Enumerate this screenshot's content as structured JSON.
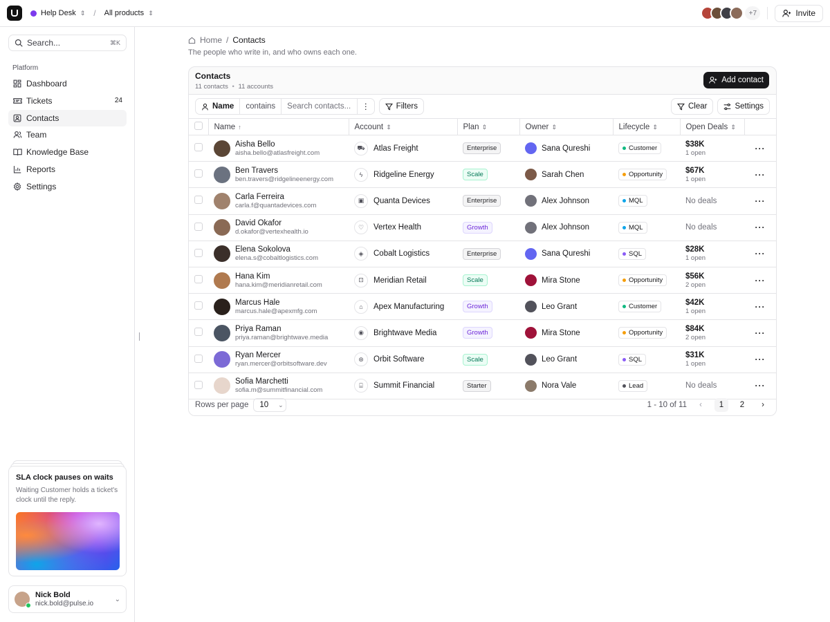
{
  "topbar": {
    "workspace": "Help Desk",
    "product_filter": "All products",
    "separator": "/",
    "team_extra_count": "+7",
    "invite_label": "Invite",
    "avatar_colors": [
      "#b5453a",
      "#6b4f3a",
      "#3f3f46",
      "#8b6b5a"
    ]
  },
  "sidebar": {
    "search_placeholder": "Search...",
    "search_shortcut": "⌘K",
    "section_label": "Platform",
    "items": [
      {
        "label": "Dashboard",
        "icon": "dashboard-icon",
        "count": ""
      },
      {
        "label": "Tickets",
        "icon": "ticket-icon",
        "count": "24"
      },
      {
        "label": "Contacts",
        "icon": "contacts-icon",
        "count": "",
        "active": true
      },
      {
        "label": "Team",
        "icon": "team-icon",
        "count": ""
      },
      {
        "label": "Knowledge Base",
        "icon": "book-icon",
        "count": ""
      },
      {
        "label": "Reports",
        "icon": "chart-icon",
        "count": ""
      },
      {
        "label": "Settings",
        "icon": "gear-icon",
        "count": ""
      }
    ],
    "promo": {
      "title": "SLA clock pauses on waits",
      "text": "Waiting Customer holds a ticket's clock until the reply."
    },
    "user": {
      "name": "Nick Bold",
      "email": "nick.bold@pulse.io"
    }
  },
  "main": {
    "breadcrumb": {
      "home": "Home",
      "separator": "/",
      "current": "Contacts"
    },
    "subtitle": "The people who write in, and who owns each one.",
    "card": {
      "title": "Contacts",
      "contacts_count": "11 contacts",
      "meta_separator": "•",
      "accounts_count": "11 accounts",
      "add_button": "Add contact"
    },
    "toolbar": {
      "filter_field": "Name",
      "filter_operator": "contains",
      "filter_placeholder": "Search contacts...",
      "filters_label": "Filters",
      "clear_label": "Clear",
      "settings_label": "Settings"
    },
    "columns": [
      "Name",
      "Account",
      "Plan",
      "Owner",
      "Lifecycle",
      "Open Deals"
    ],
    "rows": [
      {
        "name": "Aisha Bello",
        "email": "aisha.bello@atlasfreight.com",
        "account": "Atlas Freight",
        "account_icon": "truck-icon",
        "plan": "Enterprise",
        "owner": "Sana Qureshi",
        "lifecycle": "Customer",
        "life_color": "#10b981",
        "deal": "$38K",
        "deal_sub": "1 open",
        "avatar": "#5b4636",
        "owner_avatar": "#6366f1"
      },
      {
        "name": "Ben Travers",
        "email": "ben.travers@ridgelineenergy.com",
        "account": "Ridgeline Energy",
        "account_icon": "bolt-icon",
        "plan": "Scale",
        "owner": "Sarah Chen",
        "lifecycle": "Opportunity",
        "life_color": "#f59e0b",
        "deal": "$67K",
        "deal_sub": "1 open",
        "avatar": "#6b7280",
        "owner_avatar": "#7c5a48"
      },
      {
        "name": "Carla Ferreira",
        "email": "carla.f@quantadevices.com",
        "account": "Quanta Devices",
        "account_icon": "chip-icon",
        "plan": "Enterprise",
        "owner": "Alex Johnson",
        "lifecycle": "MQL",
        "life_color": "#0ea5e9",
        "deal": "No deals",
        "deal_sub": "",
        "avatar": "#a0826d",
        "owner_avatar": "#71717a"
      },
      {
        "name": "David Okafor",
        "email": "d.okafor@vertexhealth.io",
        "account": "Vertex Health",
        "account_icon": "heart-icon",
        "plan": "Growth",
        "owner": "Alex Johnson",
        "lifecycle": "MQL",
        "life_color": "#0ea5e9",
        "deal": "No deals",
        "deal_sub": "",
        "avatar": "#8a6a55",
        "owner_avatar": "#71717a"
      },
      {
        "name": "Elena Sokolova",
        "email": "elena.s@cobaltlogistics.com",
        "account": "Cobalt Logistics",
        "account_icon": "box-icon",
        "plan": "Enterprise",
        "owner": "Sana Qureshi",
        "lifecycle": "SQL",
        "life_color": "#8b5cf6",
        "deal": "$28K",
        "deal_sub": "1 open",
        "avatar": "#3b2f2a",
        "owner_avatar": "#6366f1"
      },
      {
        "name": "Hana Kim",
        "email": "hana.kim@meridianretail.com",
        "account": "Meridian Retail",
        "account_icon": "bag-icon",
        "plan": "Scale",
        "owner": "Mira Stone",
        "lifecycle": "Opportunity",
        "life_color": "#f59e0b",
        "deal": "$56K",
        "deal_sub": "2 open",
        "avatar": "#b07a4f",
        "owner_avatar": "#9f1239"
      },
      {
        "name": "Marcus Hale",
        "email": "marcus.hale@apexmfg.com",
        "account": "Apex Manufacturing",
        "account_icon": "factory-icon",
        "plan": "Growth",
        "owner": "Leo Grant",
        "lifecycle": "Customer",
        "life_color": "#10b981",
        "deal": "$42K",
        "deal_sub": "1 open",
        "avatar": "#2a211c",
        "owner_avatar": "#52525b"
      },
      {
        "name": "Priya Raman",
        "email": "priya.raman@brightwave.media",
        "account": "Brightwave Media",
        "account_icon": "signal-icon",
        "plan": "Growth",
        "owner": "Mira Stone",
        "lifecycle": "Opportunity",
        "life_color": "#f59e0b",
        "deal": "$84K",
        "deal_sub": "2 open",
        "avatar": "#4b5563",
        "owner_avatar": "#9f1239"
      },
      {
        "name": "Ryan Mercer",
        "email": "ryan.mercer@orbitsoftware.dev",
        "account": "Orbit Software",
        "account_icon": "orbit-icon",
        "plan": "Scale",
        "owner": "Leo Grant",
        "lifecycle": "SQL",
        "life_color": "#8b5cf6",
        "deal": "$31K",
        "deal_sub": "1 open",
        "avatar": "#7c6ad6",
        "owner_avatar": "#52525b"
      },
      {
        "name": "Sofia Marchetti",
        "email": "sofia.m@summitfinancial.com",
        "account": "Summit Financial",
        "account_icon": "bank-icon",
        "plan": "Starter",
        "owner": "Nora Vale",
        "lifecycle": "Lead",
        "life_color": "#52525b",
        "deal": "No deals",
        "deal_sub": "",
        "avatar": "#e7d6cc",
        "owner_avatar": "#8b7a6a"
      }
    ],
    "footer": {
      "rows_per_page_label": "Rows per page",
      "rows_per_page_value": "10",
      "range": "1 - 10 of 11",
      "pages": [
        "1",
        "2"
      ],
      "current_page": "1"
    }
  }
}
